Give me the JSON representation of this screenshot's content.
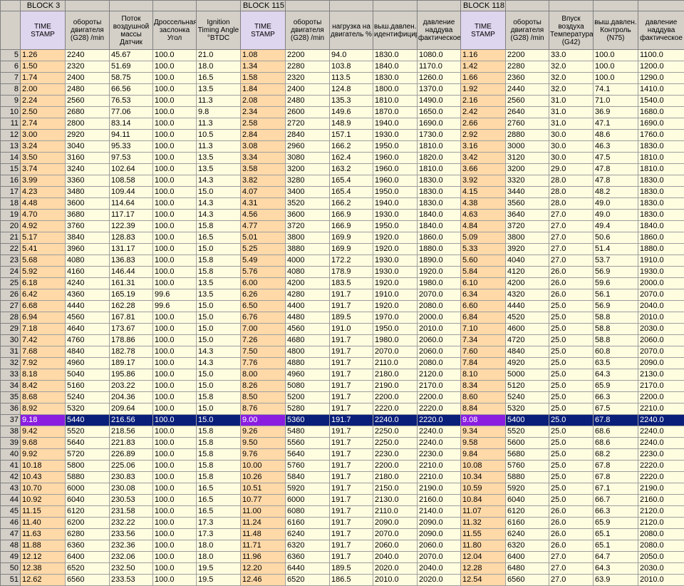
{
  "blocks": [
    {
      "name": "BLOCK 3",
      "span": 5
    },
    {
      "name": "BLOCK 115",
      "span": 5
    },
    {
      "name": "BLOCK 118",
      "span": 5
    }
  ],
  "headers": [
    "TIME STAMP",
    "обороты двигателя (G28) /min",
    "Поток воздушной массы Датчик",
    "Дроссельная заслонка Угол",
    "Ignition Timing Angle °BTDC",
    "TIME STAMP",
    "обороты двигателя (G28) /min",
    "нагрузка на двигатель %",
    "выш.давлен. идентифицирован",
    "давление наддува фактическое",
    "TIME STAMP",
    "обороты двигателя (G28) /min",
    "Впуск воздуха Температура (G42)",
    "выш.давлен. Контроль (N75)",
    "давление наддува фактическое"
  ],
  "selected_row": 37,
  "rows": [
    {
      "n": "5",
      "c": [
        "1.26",
        "2240",
        "45.67",
        "100.0",
        "21.0",
        "1.08",
        "2200",
        "94.0",
        "1830.0",
        "1080.0",
        "1.16",
        "2200",
        "33.0",
        "100.0",
        "1100.0"
      ]
    },
    {
      "n": "6",
      "c": [
        "1.50",
        "2320",
        "51.69",
        "100.0",
        "18.0",
        "1.34",
        "2280",
        "103.8",
        "1840.0",
        "1170.0",
        "1.42",
        "2280",
        "32.0",
        "100.0",
        "1200.0"
      ]
    },
    {
      "n": "7",
      "c": [
        "1.74",
        "2400",
        "58.75",
        "100.0",
        "16.5",
        "1.58",
        "2320",
        "113.5",
        "1830.0",
        "1260.0",
        "1.66",
        "2360",
        "32.0",
        "100.0",
        "1290.0"
      ]
    },
    {
      "n": "8",
      "c": [
        "2.00",
        "2480",
        "66.56",
        "100.0",
        "13.5",
        "1.84",
        "2400",
        "124.8",
        "1800.0",
        "1370.0",
        "1.92",
        "2440",
        "32.0",
        "74.1",
        "1410.0"
      ]
    },
    {
      "n": "9",
      "c": [
        "2.24",
        "2560",
        "76.53",
        "100.0",
        "11.3",
        "2.08",
        "2480",
        "135.3",
        "1810.0",
        "1490.0",
        "2.16",
        "2560",
        "31.0",
        "71.0",
        "1540.0"
      ]
    },
    {
      "n": "10",
      "c": [
        "2.50",
        "2680",
        "77.06",
        "100.0",
        "9.8",
        "2.34",
        "2600",
        "149.6",
        "1870.0",
        "1650.0",
        "2.42",
        "2640",
        "31.0",
        "36.9",
        "1680.0"
      ]
    },
    {
      "n": "11",
      "c": [
        "2.74",
        "2800",
        "83.14",
        "100.0",
        "11.3",
        "2.58",
        "2720",
        "148.9",
        "1940.0",
        "1690.0",
        "2.66",
        "2760",
        "31.0",
        "47.1",
        "1690.0"
      ]
    },
    {
      "n": "12",
      "c": [
        "3.00",
        "2920",
        "94.11",
        "100.0",
        "10.5",
        "2.84",
        "2840",
        "157.1",
        "1930.0",
        "1730.0",
        "2.92",
        "2880",
        "30.0",
        "48.6",
        "1760.0"
      ]
    },
    {
      "n": "13",
      "c": [
        "3.24",
        "3040",
        "95.33",
        "100.0",
        "11.3",
        "3.08",
        "2960",
        "166.2",
        "1950.0",
        "1810.0",
        "3.16",
        "3000",
        "30.0",
        "46.3",
        "1830.0"
      ]
    },
    {
      "n": "14",
      "c": [
        "3.50",
        "3160",
        "97.53",
        "100.0",
        "13.5",
        "3.34",
        "3080",
        "162.4",
        "1960.0",
        "1820.0",
        "3.42",
        "3120",
        "30.0",
        "47.5",
        "1810.0"
      ]
    },
    {
      "n": "15",
      "c": [
        "3.74",
        "3240",
        "102.64",
        "100.0",
        "13.5",
        "3.58",
        "3200",
        "163.2",
        "1960.0",
        "1810.0",
        "3.66",
        "3200",
        "29.0",
        "47.8",
        "1810.0"
      ]
    },
    {
      "n": "16",
      "c": [
        "3.99",
        "3360",
        "108.58",
        "100.0",
        "14.3",
        "3.82",
        "3280",
        "165.4",
        "1960.0",
        "1830.0",
        "3.92",
        "3320",
        "28.0",
        "47.8",
        "1830.0"
      ]
    },
    {
      "n": "17",
      "c": [
        "4.23",
        "3480",
        "109.44",
        "100.0",
        "15.0",
        "4.07",
        "3400",
        "165.4",
        "1950.0",
        "1830.0",
        "4.15",
        "3440",
        "28.0",
        "48.2",
        "1830.0"
      ]
    },
    {
      "n": "18",
      "c": [
        "4.48",
        "3600",
        "114.64",
        "100.0",
        "14.3",
        "4.31",
        "3520",
        "166.2",
        "1940.0",
        "1830.0",
        "4.38",
        "3560",
        "28.0",
        "49.0",
        "1830.0"
      ]
    },
    {
      "n": "19",
      "c": [
        "4.70",
        "3680",
        "117.17",
        "100.0",
        "14.3",
        "4.56",
        "3600",
        "166.9",
        "1930.0",
        "1840.0",
        "4.63",
        "3640",
        "27.0",
        "49.0",
        "1830.0"
      ]
    },
    {
      "n": "20",
      "c": [
        "4.92",
        "3760",
        "122.39",
        "100.0",
        "15.8",
        "4.77",
        "3720",
        "166.9",
        "1950.0",
        "1840.0",
        "4.84",
        "3720",
        "27.0",
        "49.4",
        "1840.0"
      ]
    },
    {
      "n": "21",
      "c": [
        "5.17",
        "3840",
        "128.83",
        "100.0",
        "16.5",
        "5.01",
        "3800",
        "169.9",
        "1920.0",
        "1860.0",
        "5.09",
        "3800",
        "27.0",
        "50.6",
        "1860.0"
      ]
    },
    {
      "n": "22",
      "c": [
        "5.41",
        "3960",
        "131.17",
        "100.0",
        "15.0",
        "5.25",
        "3880",
        "169.9",
        "1920.0",
        "1880.0",
        "5.33",
        "3920",
        "27.0",
        "51.4",
        "1880.0"
      ]
    },
    {
      "n": "23",
      "c": [
        "5.68",
        "4080",
        "136.83",
        "100.0",
        "15.8",
        "5.49",
        "4000",
        "172.2",
        "1930.0",
        "1890.0",
        "5.60",
        "4040",
        "27.0",
        "53.7",
        "1910.0"
      ]
    },
    {
      "n": "24",
      "c": [
        "5.92",
        "4160",
        "146.44",
        "100.0",
        "15.8",
        "5.76",
        "4080",
        "178.9",
        "1930.0",
        "1920.0",
        "5.84",
        "4120",
        "26.0",
        "56.9",
        "1930.0"
      ]
    },
    {
      "n": "25",
      "c": [
        "6.18",
        "4240",
        "161.31",
        "100.0",
        "13.5",
        "6.00",
        "4200",
        "183.5",
        "1920.0",
        "1980.0",
        "6.10",
        "4200",
        "26.0",
        "59.6",
        "2000.0"
      ]
    },
    {
      "n": "26",
      "c": [
        "6.42",
        "4360",
        "165.19",
        "99.6",
        "13.5",
        "6.26",
        "4280",
        "191.7",
        "1910.0",
        "2070.0",
        "6.34",
        "4320",
        "26.0",
        "56.1",
        "2070.0"
      ]
    },
    {
      "n": "27",
      "c": [
        "6.68",
        "4440",
        "162.28",
        "99.6",
        "15.0",
        "6.50",
        "4400",
        "191.7",
        "1920.0",
        "2080.0",
        "6.60",
        "4440",
        "25.0",
        "56.9",
        "2040.0"
      ]
    },
    {
      "n": "28",
      "c": [
        "6.94",
        "4560",
        "167.81",
        "100.0",
        "15.0",
        "6.76",
        "4480",
        "189.5",
        "1970.0",
        "2000.0",
        "6.84",
        "4520",
        "25.0",
        "58.8",
        "2010.0"
      ]
    },
    {
      "n": "29",
      "c": [
        "7.18",
        "4640",
        "173.67",
        "100.0",
        "15.0",
        "7.00",
        "4560",
        "191.0",
        "1950.0",
        "2010.0",
        "7.10",
        "4600",
        "25.0",
        "58.8",
        "2030.0"
      ]
    },
    {
      "n": "30",
      "c": [
        "7.42",
        "4760",
        "178.86",
        "100.0",
        "15.0",
        "7.26",
        "4680",
        "191.7",
        "1980.0",
        "2060.0",
        "7.34",
        "4720",
        "25.0",
        "58.8",
        "2060.0"
      ]
    },
    {
      "n": "31",
      "c": [
        "7.68",
        "4840",
        "182.78",
        "100.0",
        "14.3",
        "7.50",
        "4800",
        "191.7",
        "2070.0",
        "2060.0",
        "7.60",
        "4840",
        "25.0",
        "60.8",
        "2070.0"
      ]
    },
    {
      "n": "32",
      "c": [
        "7.92",
        "4960",
        "189.17",
        "100.0",
        "14.3",
        "7.76",
        "4880",
        "191.7",
        "2110.0",
        "2080.0",
        "7.84",
        "4920",
        "25.0",
        "63.5",
        "2090.0"
      ]
    },
    {
      "n": "33",
      "c": [
        "8.18",
        "5040",
        "195.86",
        "100.0",
        "15.0",
        "8.00",
        "4960",
        "191.7",
        "2180.0",
        "2120.0",
        "8.10",
        "5000",
        "25.0",
        "64.3",
        "2130.0"
      ]
    },
    {
      "n": "34",
      "c": [
        "8.42",
        "5160",
        "203.22",
        "100.0",
        "15.0",
        "8.26",
        "5080",
        "191.7",
        "2190.0",
        "2170.0",
        "8.34",
        "5120",
        "25.0",
        "65.9",
        "2170.0"
      ]
    },
    {
      "n": "35",
      "c": [
        "8.68",
        "5240",
        "204.36",
        "100.0",
        "15.8",
        "8.50",
        "5200",
        "191.7",
        "2200.0",
        "2200.0",
        "8.60",
        "5240",
        "25.0",
        "66.3",
        "2200.0"
      ]
    },
    {
      "n": "36",
      "c": [
        "8.92",
        "5320",
        "209.64",
        "100.0",
        "15.0",
        "8.76",
        "5280",
        "191.7",
        "2220.0",
        "2220.0",
        "8.84",
        "5320",
        "25.0",
        "67.5",
        "2210.0"
      ]
    },
    {
      "n": "37",
      "c": [
        "9.18",
        "5440",
        "216.56",
        "100.0",
        "15.0",
        "9.00",
        "5360",
        "191.7",
        "2240.0",
        "2220.0",
        "9.08",
        "5400",
        "25.0",
        "67.8",
        "2240.0"
      ]
    },
    {
      "n": "38",
      "c": [
        "9.42",
        "5520",
        "218.56",
        "100.0",
        "15.8",
        "9.26",
        "5480",
        "191.7",
        "2250.0",
        "2240.0",
        "9.34",
        "5520",
        "25.0",
        "68.6",
        "2240.0"
      ]
    },
    {
      "n": "39",
      "c": [
        "9.68",
        "5640",
        "221.83",
        "100.0",
        "15.8",
        "9.50",
        "5560",
        "191.7",
        "2250.0",
        "2240.0",
        "9.58",
        "5600",
        "25.0",
        "68.6",
        "2240.0"
      ]
    },
    {
      "n": "40",
      "c": [
        "9.92",
        "5720",
        "226.89",
        "100.0",
        "15.8",
        "9.76",
        "5640",
        "191.7",
        "2230.0",
        "2230.0",
        "9.84",
        "5680",
        "25.0",
        "68.2",
        "2230.0"
      ]
    },
    {
      "n": "41",
      "c": [
        "10.18",
        "5800",
        "225.06",
        "100.0",
        "15.8",
        "10.00",
        "5760",
        "191.7",
        "2200.0",
        "2210.0",
        "10.08",
        "5760",
        "25.0",
        "67.8",
        "2220.0"
      ]
    },
    {
      "n": "42",
      "c": [
        "10.43",
        "5880",
        "230.83",
        "100.0",
        "15.8",
        "10.26",
        "5840",
        "191.7",
        "2180.0",
        "2210.0",
        "10.34",
        "5880",
        "25.0",
        "67.8",
        "2220.0"
      ]
    },
    {
      "n": "43",
      "c": [
        "10.70",
        "6000",
        "230.08",
        "100.0",
        "16.5",
        "10.51",
        "5920",
        "191.7",
        "2150.0",
        "2190.0",
        "10.59",
        "5920",
        "25.0",
        "67.1",
        "2190.0"
      ]
    },
    {
      "n": "44",
      "c": [
        "10.92",
        "6040",
        "230.53",
        "100.0",
        "16.5",
        "10.77",
        "6000",
        "191.7",
        "2130.0",
        "2160.0",
        "10.84",
        "6040",
        "25.0",
        "66.7",
        "2160.0"
      ]
    },
    {
      "n": "45",
      "c": [
        "11.15",
        "6120",
        "231.58",
        "100.0",
        "16.5",
        "11.00",
        "6080",
        "191.7",
        "2110.0",
        "2140.0",
        "11.07",
        "6120",
        "26.0",
        "66.3",
        "2120.0"
      ]
    },
    {
      "n": "46",
      "c": [
        "11.40",
        "6200",
        "232.22",
        "100.0",
        "17.3",
        "11.24",
        "6160",
        "191.7",
        "2090.0",
        "2090.0",
        "11.32",
        "6160",
        "26.0",
        "65.9",
        "2120.0"
      ]
    },
    {
      "n": "47",
      "c": [
        "11.63",
        "6280",
        "233.56",
        "100.0",
        "17.3",
        "11.48",
        "6240",
        "191.7",
        "2070.0",
        "2090.0",
        "11.55",
        "6240",
        "26.0",
        "65.1",
        "2080.0"
      ]
    },
    {
      "n": "48",
      "c": [
        "11.88",
        "6360",
        "232.36",
        "100.0",
        "18.0",
        "11.71",
        "6320",
        "191.7",
        "2060.0",
        "2060.0",
        "11.80",
        "6320",
        "26.0",
        "65.1",
        "2080.0"
      ]
    },
    {
      "n": "49",
      "c": [
        "12.12",
        "6400",
        "232.06",
        "100.0",
        "18.0",
        "11.96",
        "6360",
        "191.7",
        "2040.0",
        "2070.0",
        "12.04",
        "6400",
        "27.0",
        "64.7",
        "2050.0"
      ]
    },
    {
      "n": "50",
      "c": [
        "12.38",
        "6520",
        "232.50",
        "100.0",
        "19.5",
        "12.20",
        "6440",
        "189.5",
        "2020.0",
        "2040.0",
        "12.28",
        "6480",
        "27.0",
        "64.3",
        "2030.0"
      ]
    },
    {
      "n": "51",
      "c": [
        "12.62",
        "6560",
        "233.53",
        "100.0",
        "19.5",
        "12.46",
        "6520",
        "186.5",
        "2010.0",
        "2020.0",
        "12.54",
        "6560",
        "27.0",
        "63.9",
        "2010.0"
      ]
    }
  ]
}
